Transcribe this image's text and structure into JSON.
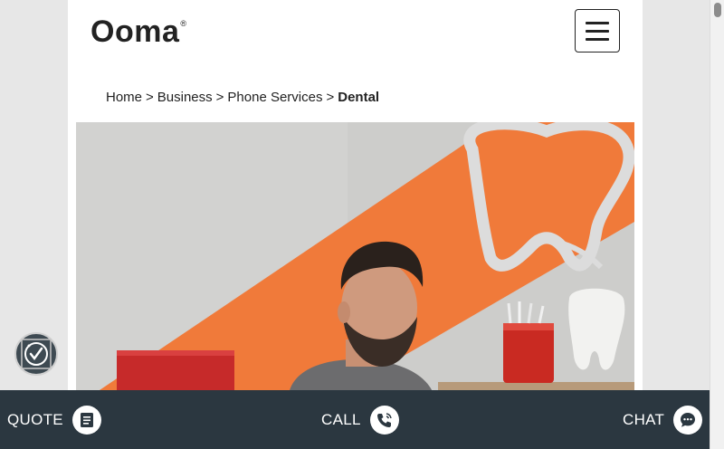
{
  "header": {
    "logo_text": "Ooma",
    "logo_mark": "®",
    "menu_icon": "hamburger-menu-icon"
  },
  "breadcrumb": {
    "items": [
      "Home",
      "Business",
      "Phone Services"
    ],
    "separator": ">",
    "current": "Dental"
  },
  "hero": {
    "description_icon": "dentist-office-photo"
  },
  "accessibility": {
    "icon": "accessibility-check-icon"
  },
  "bottom_bar": {
    "quote_label": "QUOTE",
    "call_label": "CALL",
    "chat_label": "CHAT",
    "quote_icon": "document-icon",
    "call_icon": "phone-icon",
    "chat_icon": "chat-bubble-icon"
  },
  "colors": {
    "bar_bg": "#2b3740",
    "accent_orange": "#f07a3a",
    "page_bg": "#ffffff"
  }
}
